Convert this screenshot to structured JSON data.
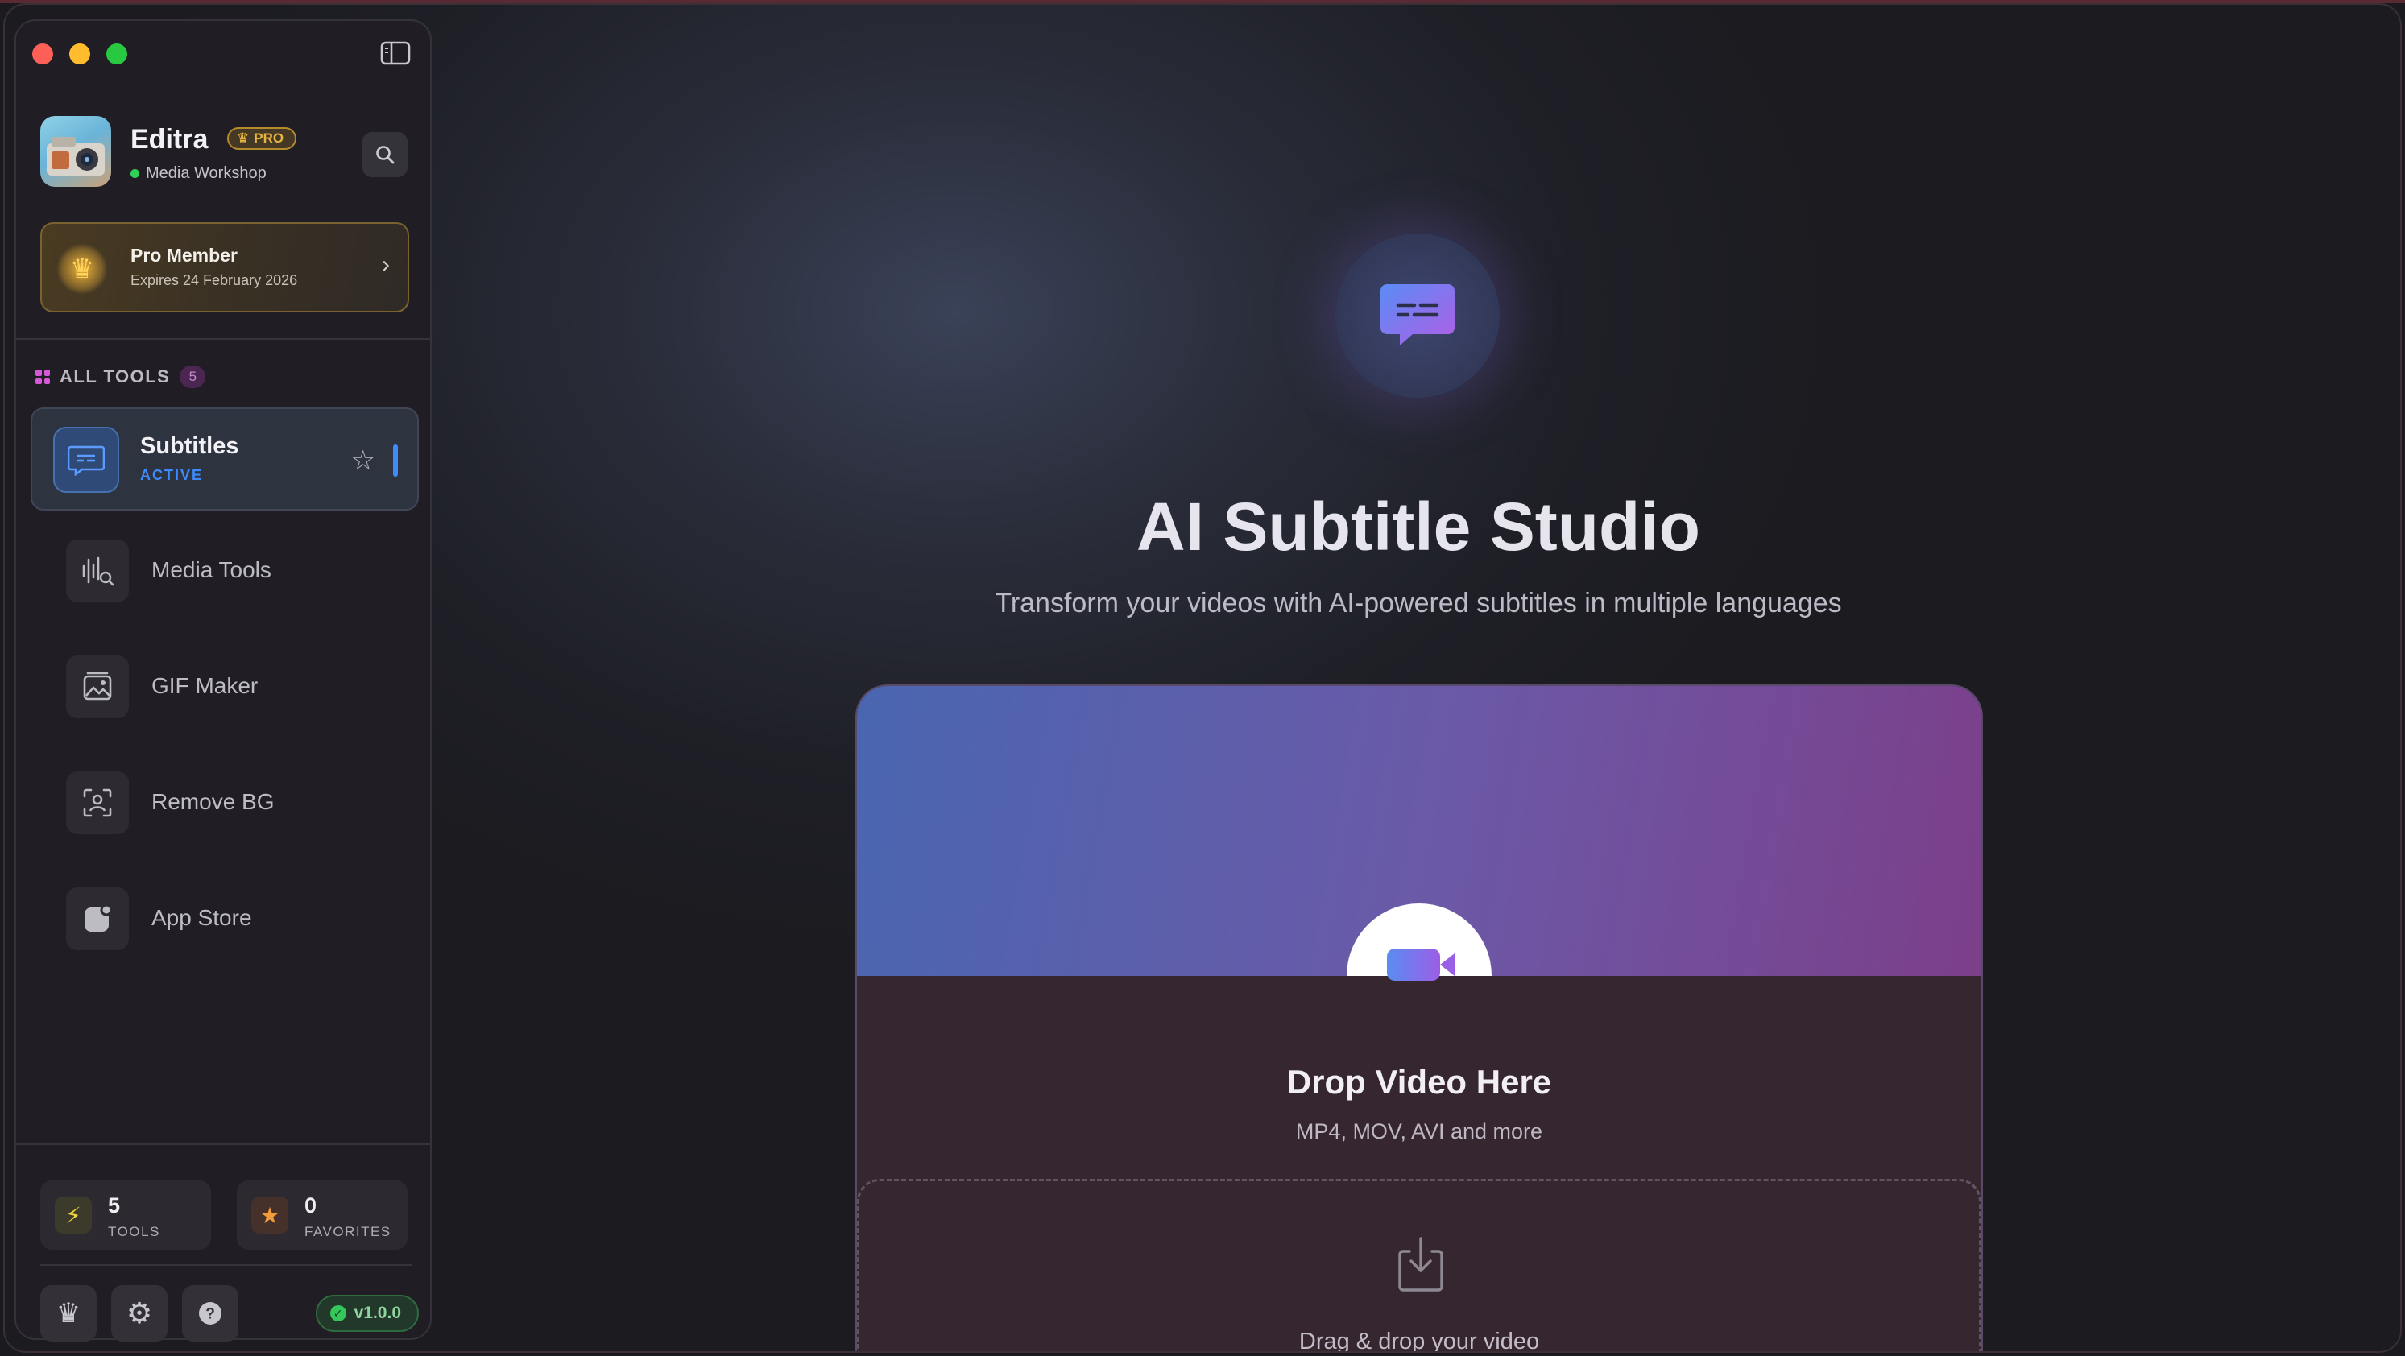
{
  "app": {
    "name": "Editra",
    "badge": "PRO",
    "workspace": "Media Workshop"
  },
  "membership": {
    "title": "Pro Member",
    "expires": "Expires 24 February 2026"
  },
  "tools_section": {
    "label": "ALL TOOLS",
    "count": "5"
  },
  "active_tool": {
    "label": "Subtitles",
    "status": "ACTIVE"
  },
  "tools": [
    {
      "label": "Media Tools",
      "icon": "waveform-search-icon"
    },
    {
      "label": "GIF Maker",
      "icon": "image-icon"
    },
    {
      "label": "Remove BG",
      "icon": "person-frame-icon"
    },
    {
      "label": "App Store",
      "icon": "app-store-icon"
    }
  ],
  "stats": {
    "tools_count": "5",
    "tools_label": "TOOLS",
    "favorites_count": "0",
    "favorites_label": "FAVORITES"
  },
  "version": "v1.0.0",
  "hero": {
    "title": "AI Subtitle Studio",
    "subtitle": "Transform your videos with AI-powered subtitles in multiple languages"
  },
  "upload": {
    "title": "Drop Video Here",
    "formats": "MP4, MOV, AVI and more",
    "drag_text": "Drag & drop your video"
  },
  "colors": {
    "accent_blue": "#3d8bff",
    "pro_gold": "#e6b640",
    "status_green": "#30d158"
  }
}
